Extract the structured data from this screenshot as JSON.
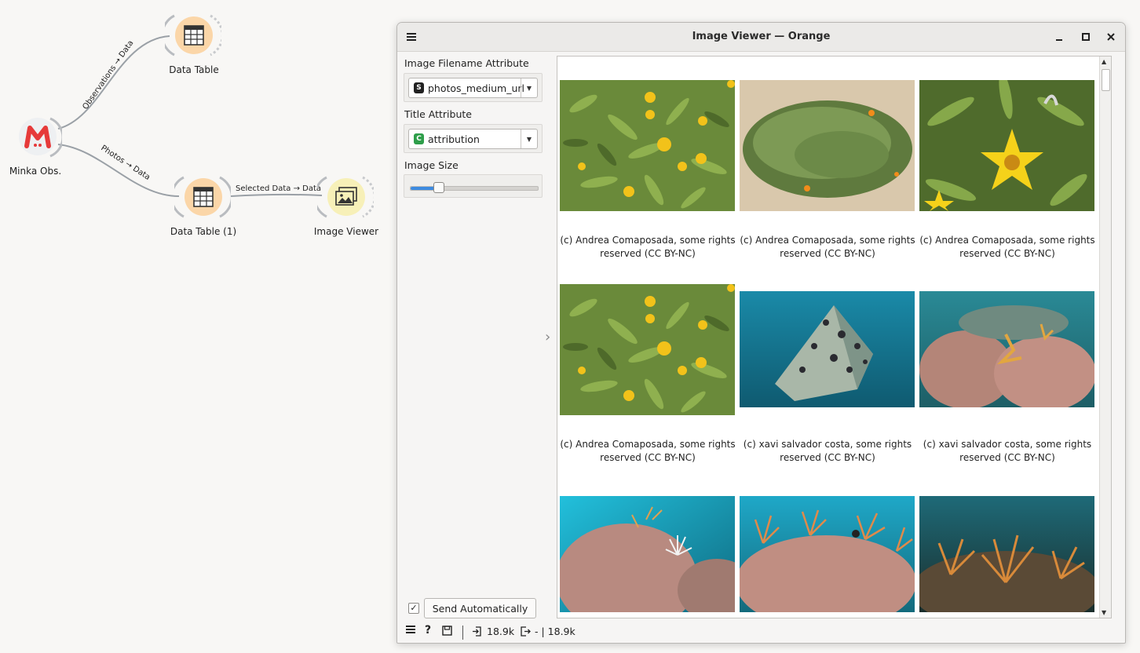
{
  "canvas": {
    "nodes": [
      {
        "id": "minka",
        "label": "Minka Obs."
      },
      {
        "id": "data_table",
        "label": "Data Table"
      },
      {
        "id": "data_table_1",
        "label": "Data Table (1)"
      },
      {
        "id": "image_viewer",
        "label": "Image Viewer"
      }
    ],
    "links": {
      "observations": "Observations → Data",
      "photos": "Photos → Data",
      "selected": "Selected Data → Data"
    }
  },
  "window": {
    "title": "Image Viewer — Orange",
    "menu_icon": "hamburger-icon",
    "buttons": {
      "minimize": "minimize-icon",
      "maximize": "maximize-icon",
      "close": "close-icon"
    }
  },
  "controls": {
    "filename_label": "Image Filename Attribute",
    "filename_value": "photos_medium_url",
    "filename_badge": "S",
    "title_label": "Title Attribute",
    "title_value": "attribution",
    "title_badge": "C",
    "size_label": "Image Size",
    "size_fraction": 0.22,
    "send_label": "Send Automatically",
    "send_checked": "✓",
    "collapse_arrow": "›"
  },
  "images": [
    {
      "caption_l1": "(c) Andrea Comaposada, some rights",
      "caption_l2": "reserved (CC BY-NC)",
      "kind": "flowers"
    },
    {
      "caption_l1": "(c) Andrea Comaposada, some rights",
      "caption_l2": "reserved (CC BY-NC)",
      "kind": "shrub"
    },
    {
      "caption_l1": "(c) Andrea Comaposada, some rights",
      "caption_l2": "reserved (CC BY-NC)",
      "kind": "flower-close"
    },
    {
      "caption_l1": "(c) Andrea Comaposada, some rights",
      "caption_l2": "reserved (CC BY-NC)",
      "kind": "flowers"
    },
    {
      "caption_l1": "(c) xavi salvador costa, some rights",
      "caption_l2": "reserved (CC BY-NC)",
      "kind": "underwater-rock"
    },
    {
      "caption_l1": "(c) xavi salvador costa, some rights",
      "caption_l2": "reserved (CC BY-NC)",
      "kind": "underwater-reef"
    },
    {
      "kind": "underwater-gorgonian"
    },
    {
      "kind": "underwater-coral"
    },
    {
      "kind": "underwater-dark"
    }
  ],
  "statusbar": {
    "input_count": "18.9k",
    "output_text": "- | 18.9k"
  },
  "colors": {
    "accent": "#3d8be0",
    "node_orange": "#fbd6a8",
    "node_yellow": "#f7f0b8",
    "link": "#9aa0a6"
  }
}
